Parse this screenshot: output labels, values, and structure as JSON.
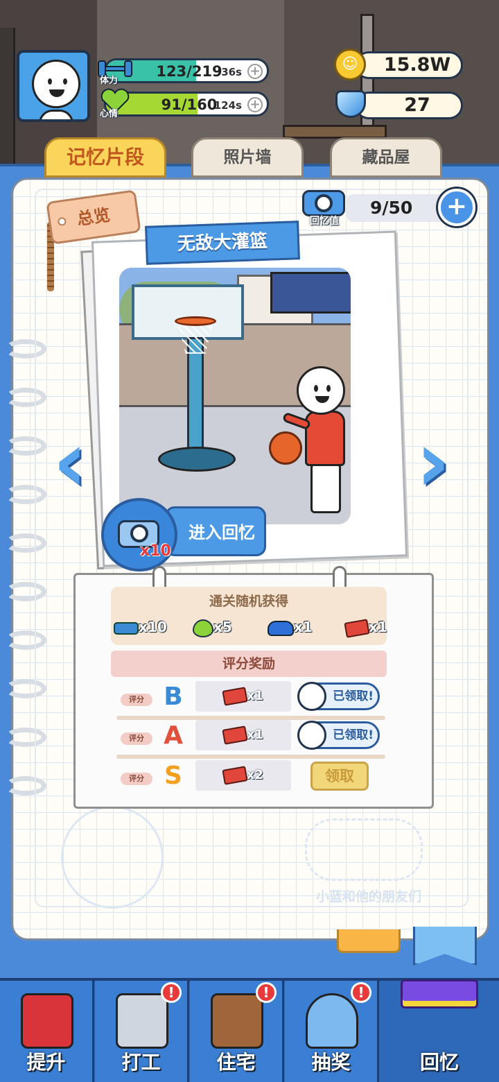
{
  "hud": {
    "stamina": {
      "label": "体力",
      "value": "123/219",
      "timer": "36s",
      "fill_fraction": 0.56
    },
    "mood": {
      "label": "心情",
      "value": "91/160",
      "timer": "124s",
      "fill_fraction": 0.57
    },
    "coins": "15.8W",
    "gems": "27"
  },
  "tabs": [
    {
      "label": "记忆片段",
      "active": true
    },
    {
      "label": "照片墙",
      "active": false
    },
    {
      "label": "藏品屋",
      "active": false
    }
  ],
  "overview_tag": "总览",
  "memory_counter": {
    "label": "回忆值",
    "value": "9/50"
  },
  "memory": {
    "title": "无敌大灌篮",
    "enter_label": "进入回忆",
    "cost": "x10"
  },
  "drops": {
    "title": "通关随机获得",
    "items": [
      {
        "icon": "dumbbell-icon",
        "count": "x10"
      },
      {
        "icon": "heart-icon",
        "count": "x5"
      },
      {
        "icon": "toy-car-icon",
        "count": "x1"
      },
      {
        "icon": "brick-icon",
        "count": "x1"
      }
    ]
  },
  "score_rewards": {
    "title": "评分奖励",
    "rows": [
      {
        "tag": "评分",
        "grade": "B",
        "grade_color": "#3a8ad4",
        "reward": "x1",
        "status": "已领取!"
      },
      {
        "tag": "评分",
        "grade": "A",
        "grade_color": "#e0503a",
        "reward": "x1",
        "status": "已领取!"
      },
      {
        "tag": "评分",
        "grade": "S",
        "grade_color": "#f2a020",
        "reward": "x2",
        "status": "领取"
      }
    ]
  },
  "watermark": "小蓝和他的朋友们",
  "bottom_nav": [
    {
      "label": "提升",
      "alert": false
    },
    {
      "label": "打工",
      "alert": true
    },
    {
      "label": "住宅",
      "alert": true
    },
    {
      "label": "抽奖",
      "alert": true
    },
    {
      "label": "回忆",
      "alert": false
    }
  ],
  "colors": {
    "accent_blue": "#4c9ae6",
    "stamina_teal": "#39c2a8",
    "mood_green": "#a6d834",
    "alert_red": "#e83a3a"
  }
}
